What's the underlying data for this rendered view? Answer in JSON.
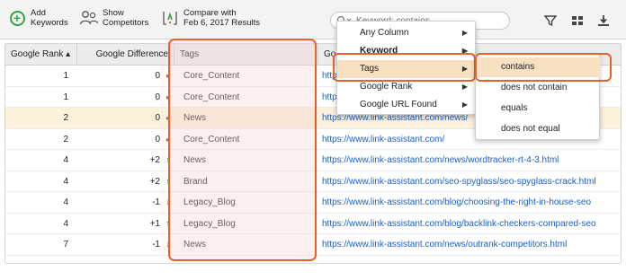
{
  "toolbar": {
    "add_label_1": "Add",
    "add_label_2": "Keywords",
    "show_label_1": "Show",
    "show_label_2": "Competitors",
    "compare_label_1": "Compare with",
    "compare_label_2": "Feb 6, 2017 Results",
    "search_placeholder": "Keyword: contains",
    "icons": [
      "add-keyword-icon",
      "competitors-icon",
      "compare-icon",
      "search-icon",
      "filter-icon",
      "columns-icon",
      "export-icon"
    ]
  },
  "table": {
    "headers": [
      "Google Rank ▴",
      "Google Difference",
      "Tags",
      "Go"
    ],
    "rows": [
      {
        "rank": "1",
        "diff": "0",
        "trend": "dot",
        "tag": "Core_Content",
        "url": "https:"
      },
      {
        "rank": "1",
        "diff": "0",
        "trend": "dot",
        "tag": "Core_Content",
        "url": "https:"
      },
      {
        "rank": "2",
        "diff": "0",
        "trend": "dot",
        "tag": "News",
        "url": "https://www.link-assistant.com/news/"
      },
      {
        "rank": "2",
        "diff": "0",
        "trend": "dot",
        "tag": "Core_Content",
        "url": "https://www.link-assistant.com/"
      },
      {
        "rank": "4",
        "diff": "+2",
        "trend": "up",
        "tag": "News",
        "url": "https://www.link-assistant.com/news/wordtracker-rt-4-3.html"
      },
      {
        "rank": "4",
        "diff": "+2",
        "trend": "up",
        "tag": "Brand",
        "url": "https://www.link-assistant.com/seo-spyglass/seo-spyglass-crack.html"
      },
      {
        "rank": "4",
        "diff": "-1",
        "trend": "down",
        "tag": "Legacy_Blog",
        "url": "https://www.link-assistant.com/blog/choosing-the-right-in-house-seo"
      },
      {
        "rank": "4",
        "diff": "+1",
        "trend": "up",
        "tag": "Legacy_Blog",
        "url": "https://www.link-assistant.com/blog/backlink-checkers-compared-seo"
      },
      {
        "rank": "7",
        "diff": "-1",
        "trend": "down",
        "tag": "News",
        "url": "https://www.link-assistant.com/news/outrank-competitors.html"
      }
    ],
    "highlighted_row": 2
  },
  "menu": {
    "items": [
      {
        "label": "Any Column",
        "has_sub": true,
        "bold": false
      },
      {
        "label": "Keyword",
        "has_sub": true,
        "bold": true
      },
      {
        "label": "Tags",
        "has_sub": true,
        "bold": false
      },
      {
        "label": "Google Rank",
        "has_sub": true,
        "bold": false
      },
      {
        "label": "Google URL Found",
        "has_sub": true,
        "bold": false
      }
    ],
    "active_index": 2,
    "submenu": [
      "contains",
      "does not contain",
      "equals",
      "does not equal"
    ],
    "submenu_active_index": 0
  },
  "colors": {
    "accent_outline": "#e8602c",
    "highlight_row": "#fbf1dd",
    "link": "#1d5fbf",
    "up": "#3aa34a",
    "down": "#e5582b"
  }
}
